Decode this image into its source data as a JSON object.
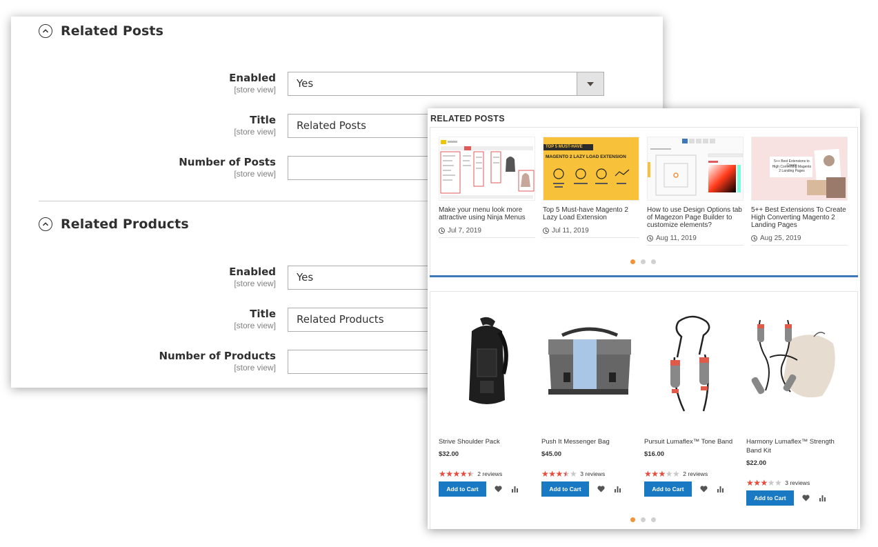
{
  "admin": {
    "related_posts": {
      "section_title": "Related Posts",
      "fields": [
        {
          "label": "Enabled",
          "scope": "[store view]",
          "value": "Yes"
        },
        {
          "label": "Title",
          "scope": "[store view]",
          "value": "Related Posts"
        },
        {
          "label": "Number of Posts",
          "scope": "[store view]",
          "value": ""
        }
      ]
    },
    "related_products": {
      "section_title": "Related Products",
      "fields": [
        {
          "label": "Enabled",
          "scope": "[store view]",
          "value": "Yes"
        },
        {
          "label": "Title",
          "scope": "[store view]",
          "value": "Related Products"
        },
        {
          "label": "Number of Products",
          "scope": "[store view]",
          "value": ""
        }
      ]
    }
  },
  "storefront": {
    "posts_heading": "RELATED POSTS",
    "posts": [
      {
        "title": "Make your menu look more attractive using Ninja Menus",
        "date": "Jul 7, 2019"
      },
      {
        "title": "Top 5 Must-have Magento 2 Lazy Load Extension",
        "date": "Jul 11, 2019",
        "thumb_text": {
          "line1": "TOP 5 MUST-HAVE",
          "line2": "MAGENTO 2 LAZY LOAD EXTENSION"
        }
      },
      {
        "title": "How to use Design Options tab of Magezon Page Builder to customize elements?",
        "date": "Aug 11, 2019"
      },
      {
        "title": "5++ Best Extensions To Create High Converting Magento 2 Landing Pages",
        "date": "Aug 25, 2019",
        "thumb_text": {
          "line1": "5++ Best Extensions to Create",
          "line2": "High Converting Magento 2 Landing Pages"
        }
      }
    ],
    "products": [
      {
        "name": "Strive Shoulder Pack",
        "price": "$32.00",
        "rating": 0.9,
        "reviews": "2 reviews",
        "cta": "Add to Cart"
      },
      {
        "name": "Push It Messenger Bag",
        "price": "$45.00",
        "rating": 0.7,
        "reviews": "3 reviews",
        "cta": "Add to Cart"
      },
      {
        "name": "Pursuit Lumaflex™ Tone Band",
        "price": "$16.00",
        "rating": 0.6,
        "reviews": "2 reviews",
        "cta": "Add to Cart"
      },
      {
        "name": "Harmony Lumaflex™ Strength Band Kit",
        "price": "$22.00",
        "rating": 0.6,
        "reviews": "3 reviews",
        "cta": "Add to Cart"
      }
    ],
    "colors": {
      "accent": "#f1933a",
      "primary_button": "#1979c3",
      "divider": "#3d78bb",
      "stars": "#e74c3c"
    }
  }
}
